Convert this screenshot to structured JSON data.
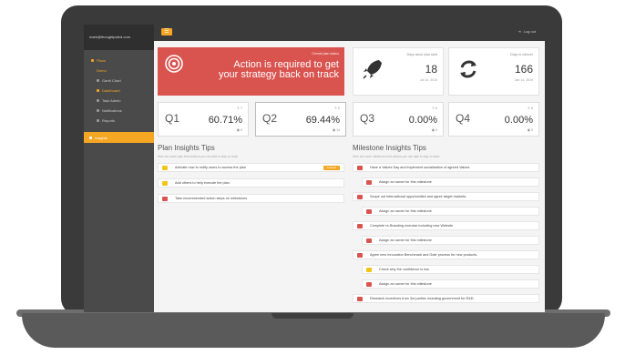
{
  "user": {
    "email": "mark@thoughtpatrol.com"
  },
  "topbar": {
    "menu_icon": "☰",
    "logout": "Log out"
  },
  "sidebar": {
    "plans": "Plans",
    "items": [
      "Demo",
      "Gantt Chart",
      "Dashboard",
      "Task Admin",
      "Notifications",
      "Reports"
    ],
    "insights": "Insights"
  },
  "alert": {
    "status_label": "Overall plan status",
    "message": "Action is required to get your strategy back on track",
    "color": "#d9534f"
  },
  "stats": [
    {
      "label": "Days since plan start",
      "value": "18",
      "date": "Jul 10, 2019",
      "icon": "rocket-icon"
    },
    {
      "label": "Days to rollover",
      "value": "166",
      "date": "Jan 14, 2019",
      "icon": "refresh-icon"
    }
  ],
  "quarters": [
    {
      "name": "Q1",
      "pct": "60.71%",
      "top": "7",
      "bottom": "0"
    },
    {
      "name": "Q2",
      "pct": "69.44%",
      "top": "0",
      "bottom": "14"
    },
    {
      "name": "Q3",
      "pct": "0.00%",
      "top": "0",
      "bottom": "0"
    },
    {
      "name": "Q4",
      "pct": "0.00%",
      "top": "0",
      "bottom": "0"
    }
  ],
  "plan_tips": {
    "title": "Plan Insights Tips",
    "subtitle": "Here are some plan level actions you can take to stay on track",
    "items": [
      {
        "text": "Activate now to notify users to access the plan",
        "color": "yellow",
        "action": "Activate"
      },
      {
        "text": "Add others to help execute the plan",
        "color": "yellow"
      },
      {
        "text": "Take recommended action steps on milestones",
        "color": "red"
      }
    ]
  },
  "milestone_tips": {
    "title": "Milestone Insights Tips",
    "subtitle": "Here are some milestone level actions you can take to stay on track",
    "items": [
      {
        "text": "Have a Values Day and implement socialisation of agreed Values",
        "color": "red",
        "level": 0
      },
      {
        "text": "Assign an owner for this milestone",
        "color": "red",
        "level": 1
      },
      {
        "text": "Scope out international opportunities and agree target markets.",
        "color": "red",
        "level": 0
      },
      {
        "text": "Assign an owner for this milestone",
        "color": "red",
        "level": 1
      },
      {
        "text": "Complete re-Branding exercise including new Website",
        "color": "red",
        "level": 0
      },
      {
        "text": "Assign an owner for this milestone",
        "color": "red",
        "level": 1
      },
      {
        "text": "Agree new Innovation Benchmark and Gate process for new products.",
        "color": "red",
        "level": 0
      },
      {
        "text": "Check why the confidence is low",
        "color": "yellow",
        "level": 1
      },
      {
        "text": "Assign an owner for this milestone",
        "color": "red",
        "level": 1
      },
      {
        "text": "Research incentives from 3rd parties including government for R&D.",
        "color": "red",
        "level": 0
      }
    ]
  }
}
